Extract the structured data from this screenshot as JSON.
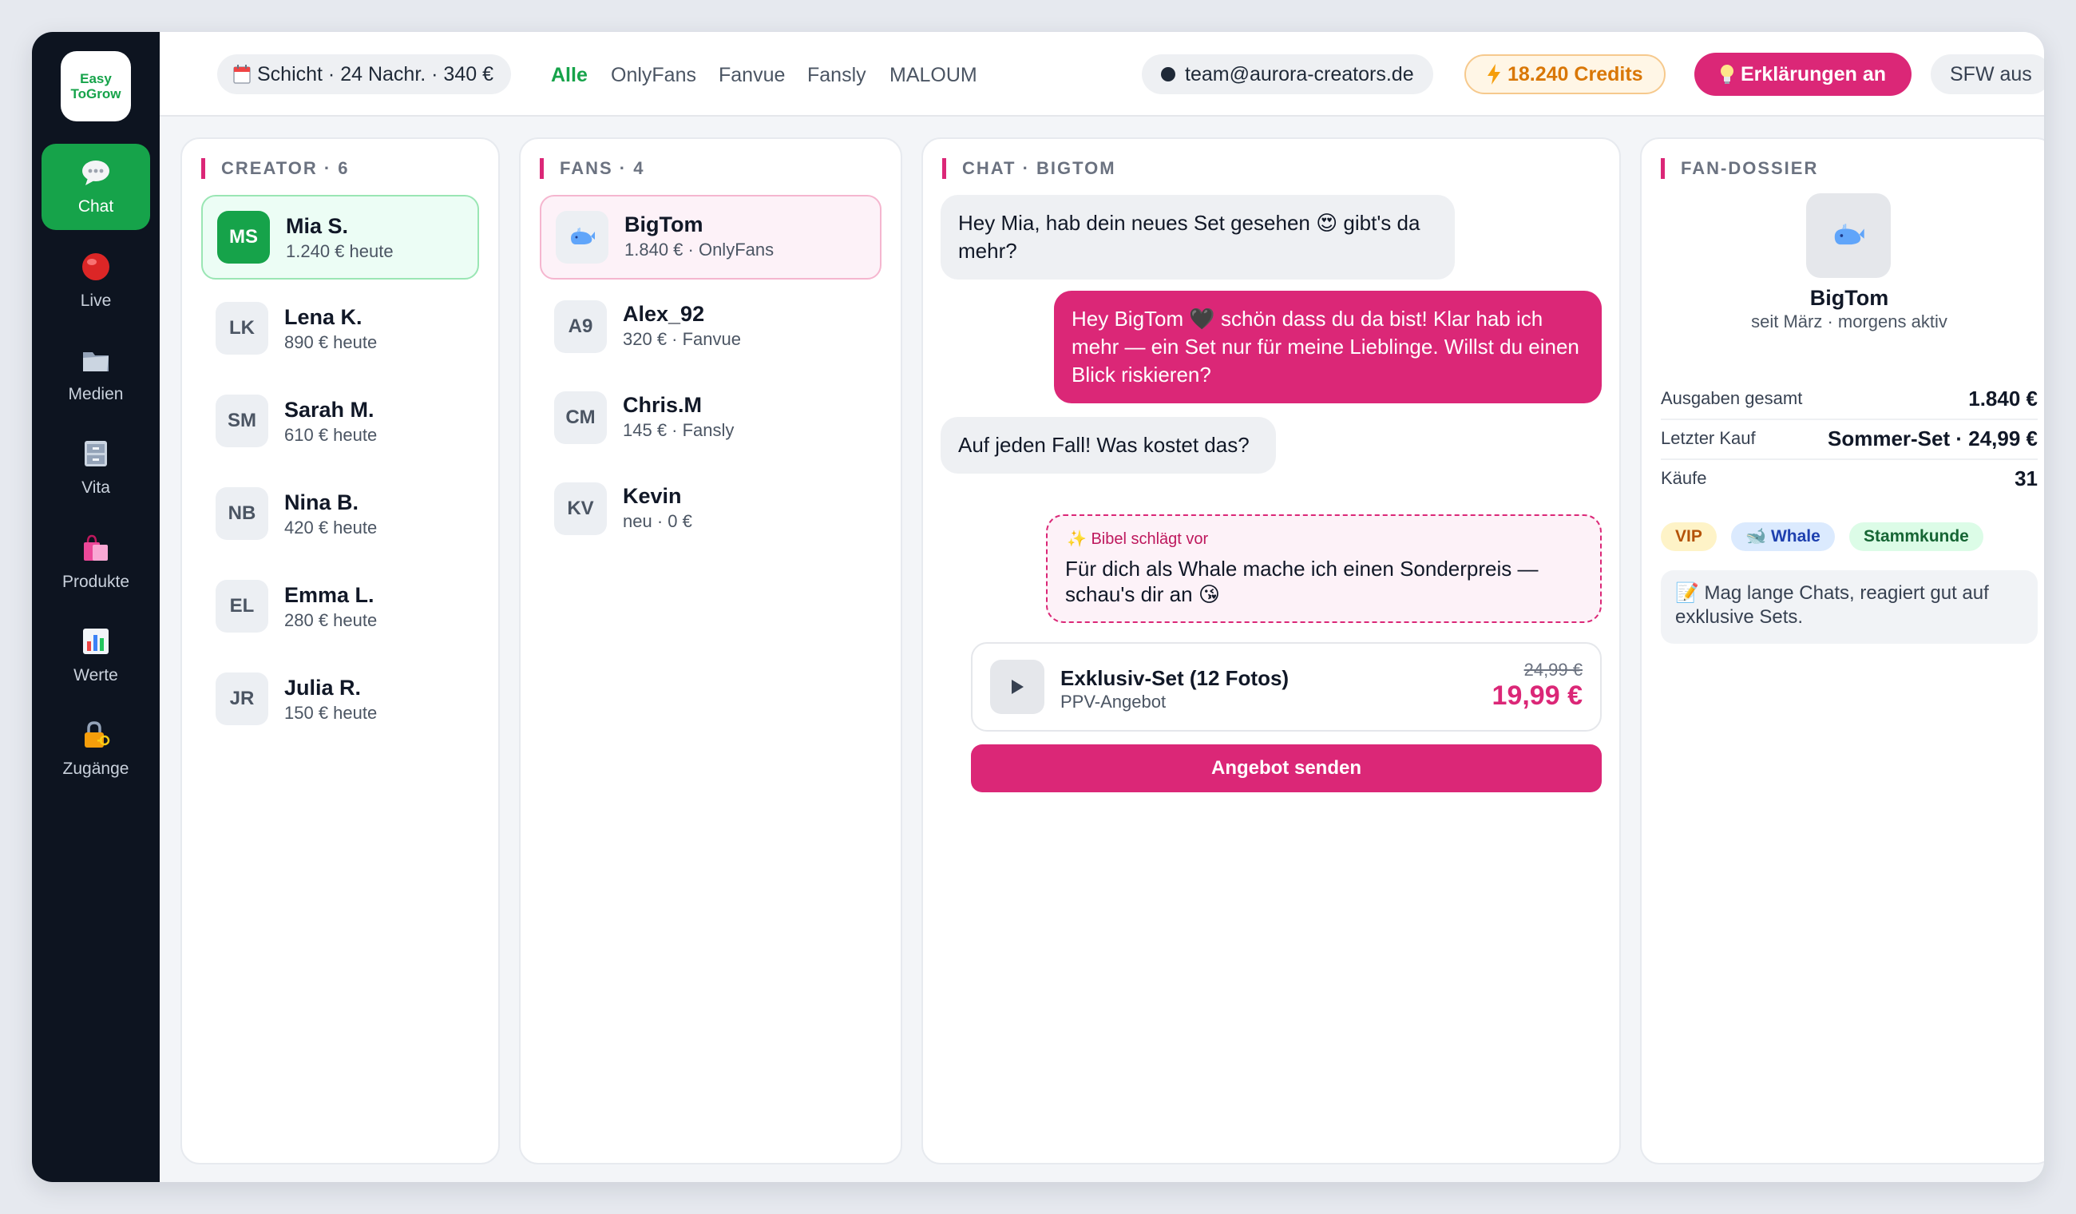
{
  "logo": {
    "line1": "Easy",
    "line2": "ToGrow"
  },
  "sidebar": {
    "items": [
      {
        "label": "Chat",
        "icon": "speech-bubble-icon"
      },
      {
        "label": "Live",
        "icon": "red-circle-icon"
      },
      {
        "label": "Medien",
        "icon": "folder-icon"
      },
      {
        "label": "Vita",
        "icon": "file-cabinet-icon"
      },
      {
        "label": "Produkte",
        "icon": "shopping-bags-icon"
      },
      {
        "label": "Werte",
        "icon": "bar-chart-icon"
      },
      {
        "label": "Zugänge",
        "icon": "lock-key-icon"
      }
    ]
  },
  "topbar": {
    "shift": "Schicht · 24 Nachr. · 340 €",
    "tabs": [
      "Alle",
      "OnlyFans",
      "Fanvue",
      "Fansly",
      "MALOUM"
    ],
    "email": "team@aurora-creators.de",
    "credits": "18.240 Credits",
    "explanations": "Erklärungen an",
    "sfw": "SFW aus"
  },
  "creators": {
    "title": "CREATOR · 6",
    "items": [
      {
        "initials": "MS",
        "name": "Mia S.",
        "sub": "1.240 € heute"
      },
      {
        "initials": "LK",
        "name": "Lena K.",
        "sub": "890 € heute"
      },
      {
        "initials": "SM",
        "name": "Sarah M.",
        "sub": "610 € heute"
      },
      {
        "initials": "NB",
        "name": "Nina B.",
        "sub": "420 € heute"
      },
      {
        "initials": "EL",
        "name": "Emma L.",
        "sub": "280 € heute"
      },
      {
        "initials": "JR",
        "name": "Julia R.",
        "sub": "150 € heute"
      }
    ]
  },
  "fans": {
    "title": "FANS · 4",
    "items": [
      {
        "initials": "",
        "icon": "whale-icon",
        "name": "BigTom",
        "sub": "1.840 € · OnlyFans"
      },
      {
        "initials": "A9",
        "name": "Alex_92",
        "sub": "320 € · Fanvue"
      },
      {
        "initials": "CM",
        "name": "Chris.M",
        "sub": "145 € · Fansly"
      },
      {
        "initials": "KV",
        "name": "Kevin",
        "sub": "neu · 0 €"
      }
    ]
  },
  "chat": {
    "title": "CHAT · BIGTOM",
    "messages": [
      {
        "dir": "in",
        "text": "Hey Mia, hab dein neues Set gesehen 😍 gibt's da mehr?"
      },
      {
        "dir": "out",
        "text": "Hey BigTom 🖤 schön dass du da bist! Klar hab ich mehr — ein Set nur für meine Lieblinge. Willst du einen Blick riskieren?"
      },
      {
        "dir": "in",
        "text": "Auf jeden Fall! Was kostet das?"
      }
    ],
    "suggestion": {
      "label": "✨ Bibel schlägt vor",
      "text": "Für dich als Whale mache ich einen Sonderpreis — schau's dir an 😘"
    },
    "offer": {
      "title": "Exklusiv-Set (12 Fotos)",
      "subtitle": "PPV-Angebot",
      "old_price": "24,99 €",
      "price": "19,99 €"
    },
    "send_label": "Angebot senden"
  },
  "dossier": {
    "title": "FAN-DOSSIER",
    "name": "BigTom",
    "sub": "seit März · morgens aktiv",
    "stats": [
      {
        "label": "Ausgaben gesamt",
        "value": "1.840 €"
      },
      {
        "label": "Letzter Kauf",
        "value": "Sommer-Set · 24,99 €"
      },
      {
        "label": "Käufe",
        "value": "31"
      }
    ],
    "tags": [
      "VIP",
      "🐋 Whale",
      "Stammkunde"
    ],
    "note": "📝 Mag lange Chats, reagiert gut auf exklusive Sets."
  },
  "colors": {
    "accent_pink": "#db2777",
    "accent_green": "#16a34a",
    "sidebar_bg": "#0d1420",
    "credits_orange": "#d97706"
  }
}
